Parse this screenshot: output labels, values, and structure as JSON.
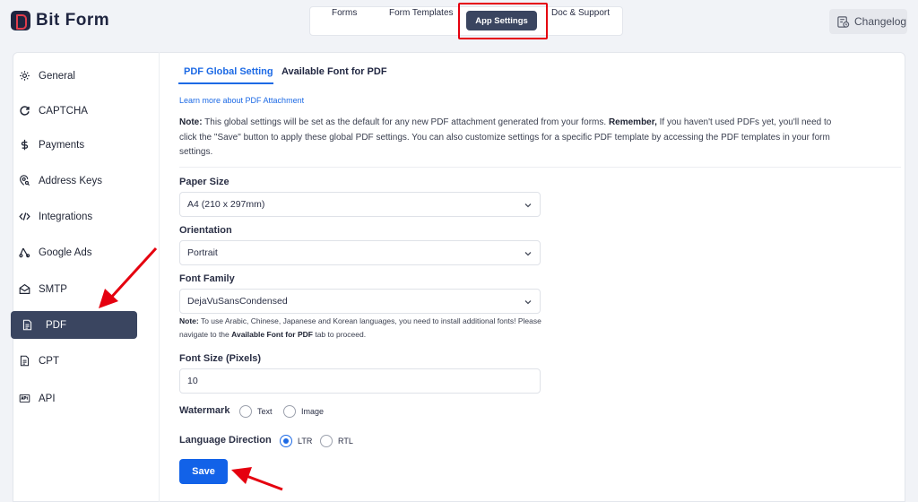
{
  "app": {
    "name": "Bit Form"
  },
  "nav": {
    "items": [
      "Forms",
      "Form Templates",
      "App Settings",
      "Doc & Support"
    ],
    "active": "App Settings",
    "changelog": "Changelog"
  },
  "sidebar": {
    "items": [
      {
        "label": "General",
        "icon": "gear-icon"
      },
      {
        "label": "CAPTCHA",
        "icon": "captcha-icon"
      },
      {
        "label": "Payments",
        "icon": "dollar-icon"
      },
      {
        "label": "Address Keys",
        "icon": "location-key-icon"
      },
      {
        "label": "Integrations",
        "icon": "code-icon"
      },
      {
        "label": "Google Ads",
        "icon": "google-ads-icon"
      },
      {
        "label": "SMTP",
        "icon": "envelope-icon"
      },
      {
        "label": "PDF",
        "icon": "pdf-file-icon"
      },
      {
        "label": "CPT",
        "icon": "document-icon"
      },
      {
        "label": "API",
        "icon": "api-icon"
      }
    ],
    "active": "PDF"
  },
  "tabs": {
    "active": "PDF Global Setting",
    "inactive": "Available Font for PDF"
  },
  "link": "Learn more about PDF Attachment",
  "note": {
    "prefix": "Note:",
    "text1": " This global settings will be set as the default for any new PDF attachment generated from your forms. ",
    "bold2": "Remember,",
    "text2": " If you haven't used PDFs yet, you'll need to click the \"Save\" button to apply these global PDF settings. You can also customize settings for a specific PDF template by accessing the PDF templates in your form settings."
  },
  "fields": {
    "paper_size": {
      "label": "Paper Size",
      "value": "A4 (210 x 297mm)"
    },
    "orientation": {
      "label": "Orientation",
      "value": "Portrait"
    },
    "font_family": {
      "label": "Font Family",
      "value": "DejaVuSansCondensed"
    },
    "font_note": {
      "prefix": "Note:",
      "text1": " To use Arabic, Chinese, Japanese and Korean languages, you need to install additional fonts! Please navigate to the ",
      "bold": "Available Font for PDF",
      "text2": " tab to proceed."
    },
    "font_size": {
      "label": "Font Size (Pixels)",
      "value": "10"
    },
    "watermark": {
      "label": "Watermark",
      "options": [
        "Text",
        "Image"
      ],
      "selected": ""
    },
    "direction": {
      "label": "Language Direction",
      "options": [
        "LTR",
        "RTL"
      ],
      "selected": "LTR"
    }
  },
  "save_label": "Save",
  "colors": {
    "accent": "#1d6ae5",
    "nav_active": "#3a4560",
    "highlight": "#e5000f"
  }
}
